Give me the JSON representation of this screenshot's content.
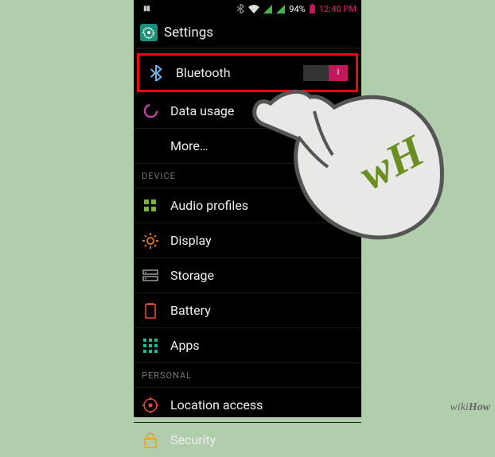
{
  "status": {
    "battery_pct": "94%",
    "clock": "12:40 PM"
  },
  "title": "Settings",
  "rows": {
    "bluetooth": "Bluetooth",
    "data_usage": "Data usage",
    "more": "More…"
  },
  "sect_device": "DEVICE",
  "device": {
    "audio": "Audio profiles",
    "display": "Display",
    "storage": "Storage",
    "battery": "Battery",
    "apps": "Apps"
  },
  "sect_personal": "PERSONAL",
  "personal": {
    "location": "Location access",
    "security": "Security"
  },
  "toggle_on": "I",
  "wh_text": "wH",
  "watermark": "wikiHow"
}
